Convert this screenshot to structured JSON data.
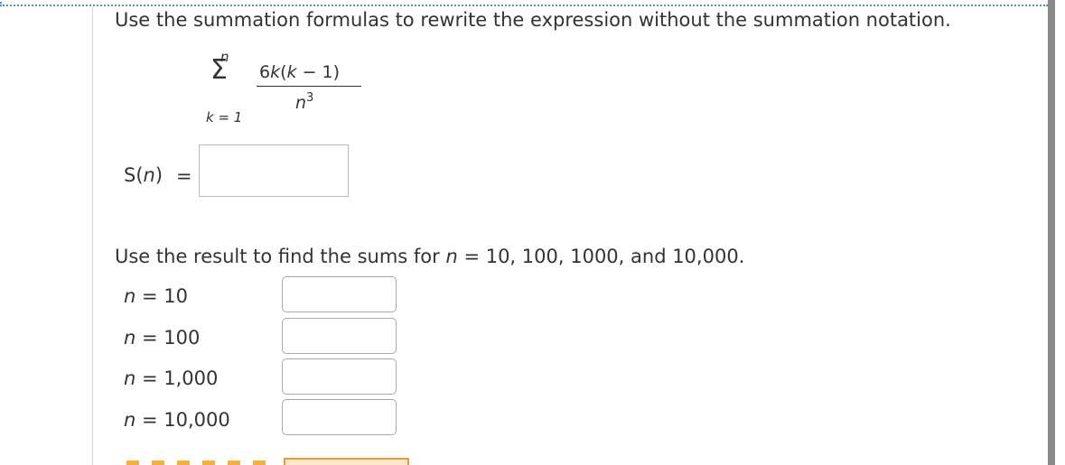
{
  "prompt": "Use the summation formulas to rewrite the expression without the summation notation.",
  "summation": {
    "upper": "n",
    "symbol": "Σ",
    "lower": "k = 1",
    "numerator_coef": "6",
    "numerator_var": "k",
    "numerator_paren_open": "(",
    "numerator_inner_var": "k",
    "numerator_rest": " − 1)",
    "denominator_var": "n",
    "denominator_exp": "3"
  },
  "sn": {
    "label_prefix": "S(",
    "label_var": "n",
    "label_suffix": ")",
    "equals": "=",
    "value": ""
  },
  "result_prompt": {
    "before": "Use the result to find the sums for ",
    "var": "n",
    "after": " = 10, 100, 1000, and 10,000."
  },
  "rows": [
    {
      "var": "n",
      "label": " = 10",
      "value": ""
    },
    {
      "var": "n",
      "label": " = 100",
      "value": ""
    },
    {
      "var": "n",
      "label": " = 1,000",
      "value": ""
    },
    {
      "var": "n",
      "label": " = 10,000",
      "value": ""
    }
  ],
  "colors": {
    "accent_dotted": "#4a90d9",
    "orange": "#e89a3c"
  }
}
